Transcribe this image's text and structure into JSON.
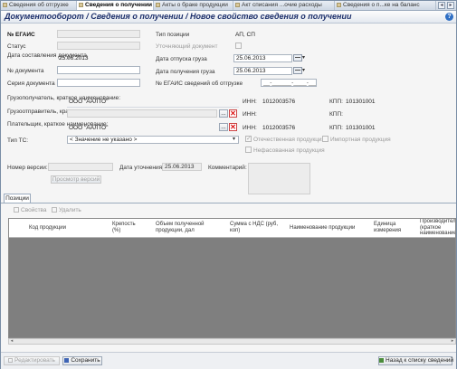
{
  "tabs": [
    {
      "label": "Сведения об отгрузке",
      "active": false
    },
    {
      "label": "Сведения о получении",
      "active": true
    },
    {
      "label": "Акты о браке продукции",
      "active": false
    },
    {
      "label": "Акт списания ...очие расходы",
      "active": false
    },
    {
      "label": "Сведения о п...ке на баланс",
      "active": false
    }
  ],
  "title": "Документооборот  / Сведения о получении / Новое свойство сведения о получении",
  "form": {
    "egais_label": "№ ЕГАИС",
    "status_label": "Статус",
    "doc_date_label": "Дата составления документа",
    "doc_date_value": "25.06.2013",
    "doc_number_label": "№ документа",
    "doc_series_label": "Серия  документа",
    "position_type_label": "Тип позиции",
    "position_type_value": "АП, СП",
    "clarifying_doc_label": "Уточняющий документ",
    "ship_date_label": "Дата отпуска груза",
    "ship_date_value": "25.06.2013",
    "receive_date_label": "Дата получения груза",
    "receive_date_value": "25.06.2013",
    "egais_ship_label": "№ ЕГАИС сведений об отгрузке",
    "egais_ship_value": "__-______-____-____-__",
    "consignee_label": "Грузополучатель, краткое наименование:",
    "consignee_value": "ООО \"ААЛТО\"",
    "consignor_label": "Грузоотправитель, краткое наименование:",
    "payer_label": "Плательщик, краткое наименование:",
    "payer_value": "ООО \"ААЛТО\"",
    "inn_label": "ИНН:",
    "inn_value_1": "1012003576",
    "inn_value_3": "1012003576",
    "kpp_label": "КПП:",
    "kpp_value_1": "101301001",
    "kpp_value_3": "101301001",
    "ts_type_label": "Тип ТС:",
    "ts_type_value": "< Значение не указано >",
    "domestic_label": "Отечественная продукция",
    "import_label": "Импортная продукция",
    "unpacked_label": "Нефасованная продукция",
    "version_label": "Номер версии:",
    "clarify_date_label": "Дата уточнения:",
    "clarify_date_value": "25.06.2013",
    "comment_label": "Комментарий:",
    "view_versions_label": "Просмотр версий"
  },
  "positions": {
    "tab_label": "Позиции",
    "properties_label": "Свойства",
    "delete_label": "Удалить",
    "columns": [
      "Код продукции",
      "Крепость (%)",
      "Объем полученной продукции, дал",
      "Сумма с НДС (руб, коп)",
      "Наименование продукции",
      "Единица измерения",
      "Производитель (краткое наименование"
    ]
  },
  "footer": {
    "edit_label": "Редактировать",
    "save_label": "Сохранить",
    "back_label": "Назад к списку сведений"
  },
  "colors": {
    "title": "#1c2f6b",
    "accent": "#2f6fc4",
    "grid_bg": "#7f7f7f"
  }
}
